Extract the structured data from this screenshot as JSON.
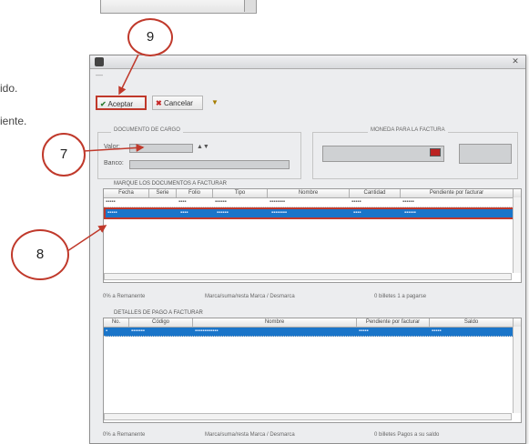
{
  "doc": {
    "snippet1": "ido.",
    "snippet2": "iente."
  },
  "callouts": {
    "c9": "9",
    "c7": "7",
    "c8": "8"
  },
  "window": {
    "close_glyph": "✕"
  },
  "toolbar": {
    "accept_label": "Aceptar",
    "cancel_label": "Cancelar",
    "filter_label": "",
    "accent_color": "#2e7d32",
    "cancel_color": "#c62828"
  },
  "group_documento": {
    "title": "DOCUMENTO DE CARGO",
    "label_valor": "Valor:",
    "label_banco": "Banco:"
  },
  "group_moneda": {
    "title": "MONEDA PARA LA FACTURA"
  },
  "grid_top": {
    "title": "MARQUE LOS DOCUMENTOS A FACTURAR",
    "headers": [
      "Fecha",
      "Serie",
      "Folio",
      "Tipo",
      "Nombre",
      "Cantidad",
      "Pendiente por facturar"
    ],
    "status_left": "0% a Remanente",
    "status_mid": "Marca/suma/resta   Marca / Desmarca",
    "status_right": "0 billetes   1 a pagarse"
  },
  "grid_bottom": {
    "title": "DETALLES DE PAGO A FACTURAR",
    "headers": [
      "No.",
      "Código",
      "Nombre",
      "Pendiente por facturar",
      "Saldo"
    ],
    "status_left": "0% a Remanente",
    "status_mid": "Marca/suma/resta   Marca / Desmarca",
    "status_right": "0 billetes   Pagos a su saldo"
  },
  "colors": {
    "selection": "#1a75c9",
    "callout_ring": "#c0392b"
  }
}
